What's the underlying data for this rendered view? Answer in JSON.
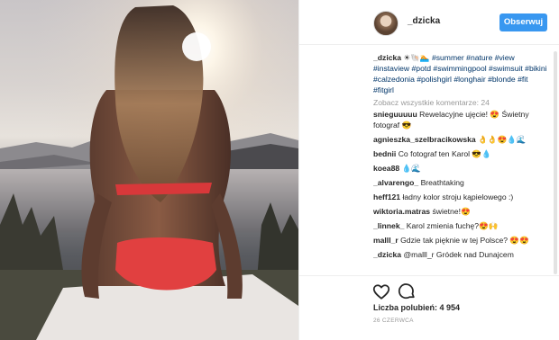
{
  "post": {
    "author": "_dzicka",
    "follow_label": "Obserwuj",
    "caption_user": "_dzicka",
    "caption_emoji": " ☀🐚🏊 ",
    "caption_tags": [
      "#summer",
      "#nature",
      "#view",
      "#instaview",
      "#potd",
      "#swimmingpool",
      "#swimsuit",
      "#bikini",
      "#calzedonia",
      "#polishgirl",
      "#longhair",
      "#blonde",
      "#fit",
      "#fitgirl"
    ],
    "more_comments": "Zobacz wszystkie komentarze: 24",
    "comments": [
      {
        "user": "snieguuuuu",
        "text": "Rewelacyjne ujęcie! 😍 Świetny fotograf 😎"
      },
      {
        "user": "agnieszka_szelbracikowska",
        "text": "👌👌😍💧🌊"
      },
      {
        "user": "bednii",
        "text": "Co fotograf ten Karol 😎💧"
      },
      {
        "user": "koea88",
        "text": "💧🌊"
      },
      {
        "user": "_alvarengo_",
        "text": "Breathtaking"
      },
      {
        "user": "heff121",
        "text": "ładny kolor stroju kąpielowego :)"
      },
      {
        "user": "wiktoria.matras",
        "text": "świetne!😍"
      },
      {
        "user": "_linnek_",
        "text": "Karol zmienia fuchę?😍🙌"
      },
      {
        "user": "malll_r",
        "text": "Gdzie tak pięknie w tej Polsce? 😍😍"
      },
      {
        "user": "_dzicka",
        "text": "@malll_r Gródek nad Dunajcem"
      }
    ],
    "likes": "Liczba polubień: 4 954",
    "date": "26 CZERWCA",
    "icons": {
      "like": "heart-icon",
      "comment": "comment-icon",
      "avatar": "avatar"
    },
    "colors": {
      "follow_bg": "#3897f0",
      "hashtag": "#003569",
      "muted": "#999999"
    }
  }
}
